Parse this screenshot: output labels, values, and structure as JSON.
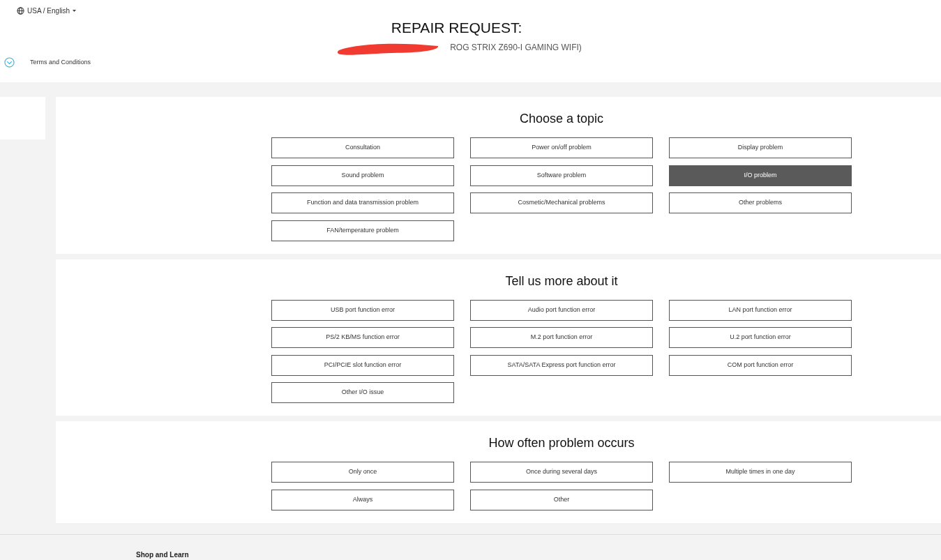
{
  "locale": {
    "label": "USA / English"
  },
  "title": "REPAIR REQUEST:",
  "subtitle": "ROG STRIX Z690-I GAMING WIFI)",
  "terms": {
    "label": "Terms and Conditions"
  },
  "sections": [
    {
      "heading": "Choose a topic",
      "options": [
        {
          "label": "Consultation",
          "selected": false
        },
        {
          "label": "Power on/off problem",
          "selected": false
        },
        {
          "label": "Display problem",
          "selected": false
        },
        {
          "label": "Sound problem",
          "selected": false
        },
        {
          "label": "Software problem",
          "selected": false
        },
        {
          "label": "I/O problem",
          "selected": true
        },
        {
          "label": "Function and data transmission problem",
          "selected": false
        },
        {
          "label": "Cosmetic/Mechanical problems",
          "selected": false
        },
        {
          "label": "Other problems",
          "selected": false
        },
        {
          "label": "FAN/temperature problem",
          "selected": false
        }
      ]
    },
    {
      "heading": "Tell us more about it",
      "options": [
        {
          "label": "USB port function error",
          "selected": false
        },
        {
          "label": "Audio port function error",
          "selected": false
        },
        {
          "label": "LAN port function error",
          "selected": false
        },
        {
          "label": "PS/2 KB/MS function error",
          "selected": false
        },
        {
          "label": "M.2 port function error",
          "selected": false
        },
        {
          "label": "U.2 port function error",
          "selected": false
        },
        {
          "label": "PCI/PCIE slot function error",
          "selected": false
        },
        {
          "label": "SATA/SATA Express port function error",
          "selected": false
        },
        {
          "label": "COM port function error",
          "selected": false
        },
        {
          "label": "Other I/O issue",
          "selected": false
        }
      ]
    },
    {
      "heading": "How often problem occurs",
      "options": [
        {
          "label": "Only once",
          "selected": false
        },
        {
          "label": "Once during several days",
          "selected": false
        },
        {
          "label": "Multiple times in one day",
          "selected": false
        },
        {
          "label": "Always",
          "selected": false
        },
        {
          "label": "Other",
          "selected": false
        }
      ]
    }
  ],
  "footer": {
    "heading": "Shop and Learn"
  }
}
